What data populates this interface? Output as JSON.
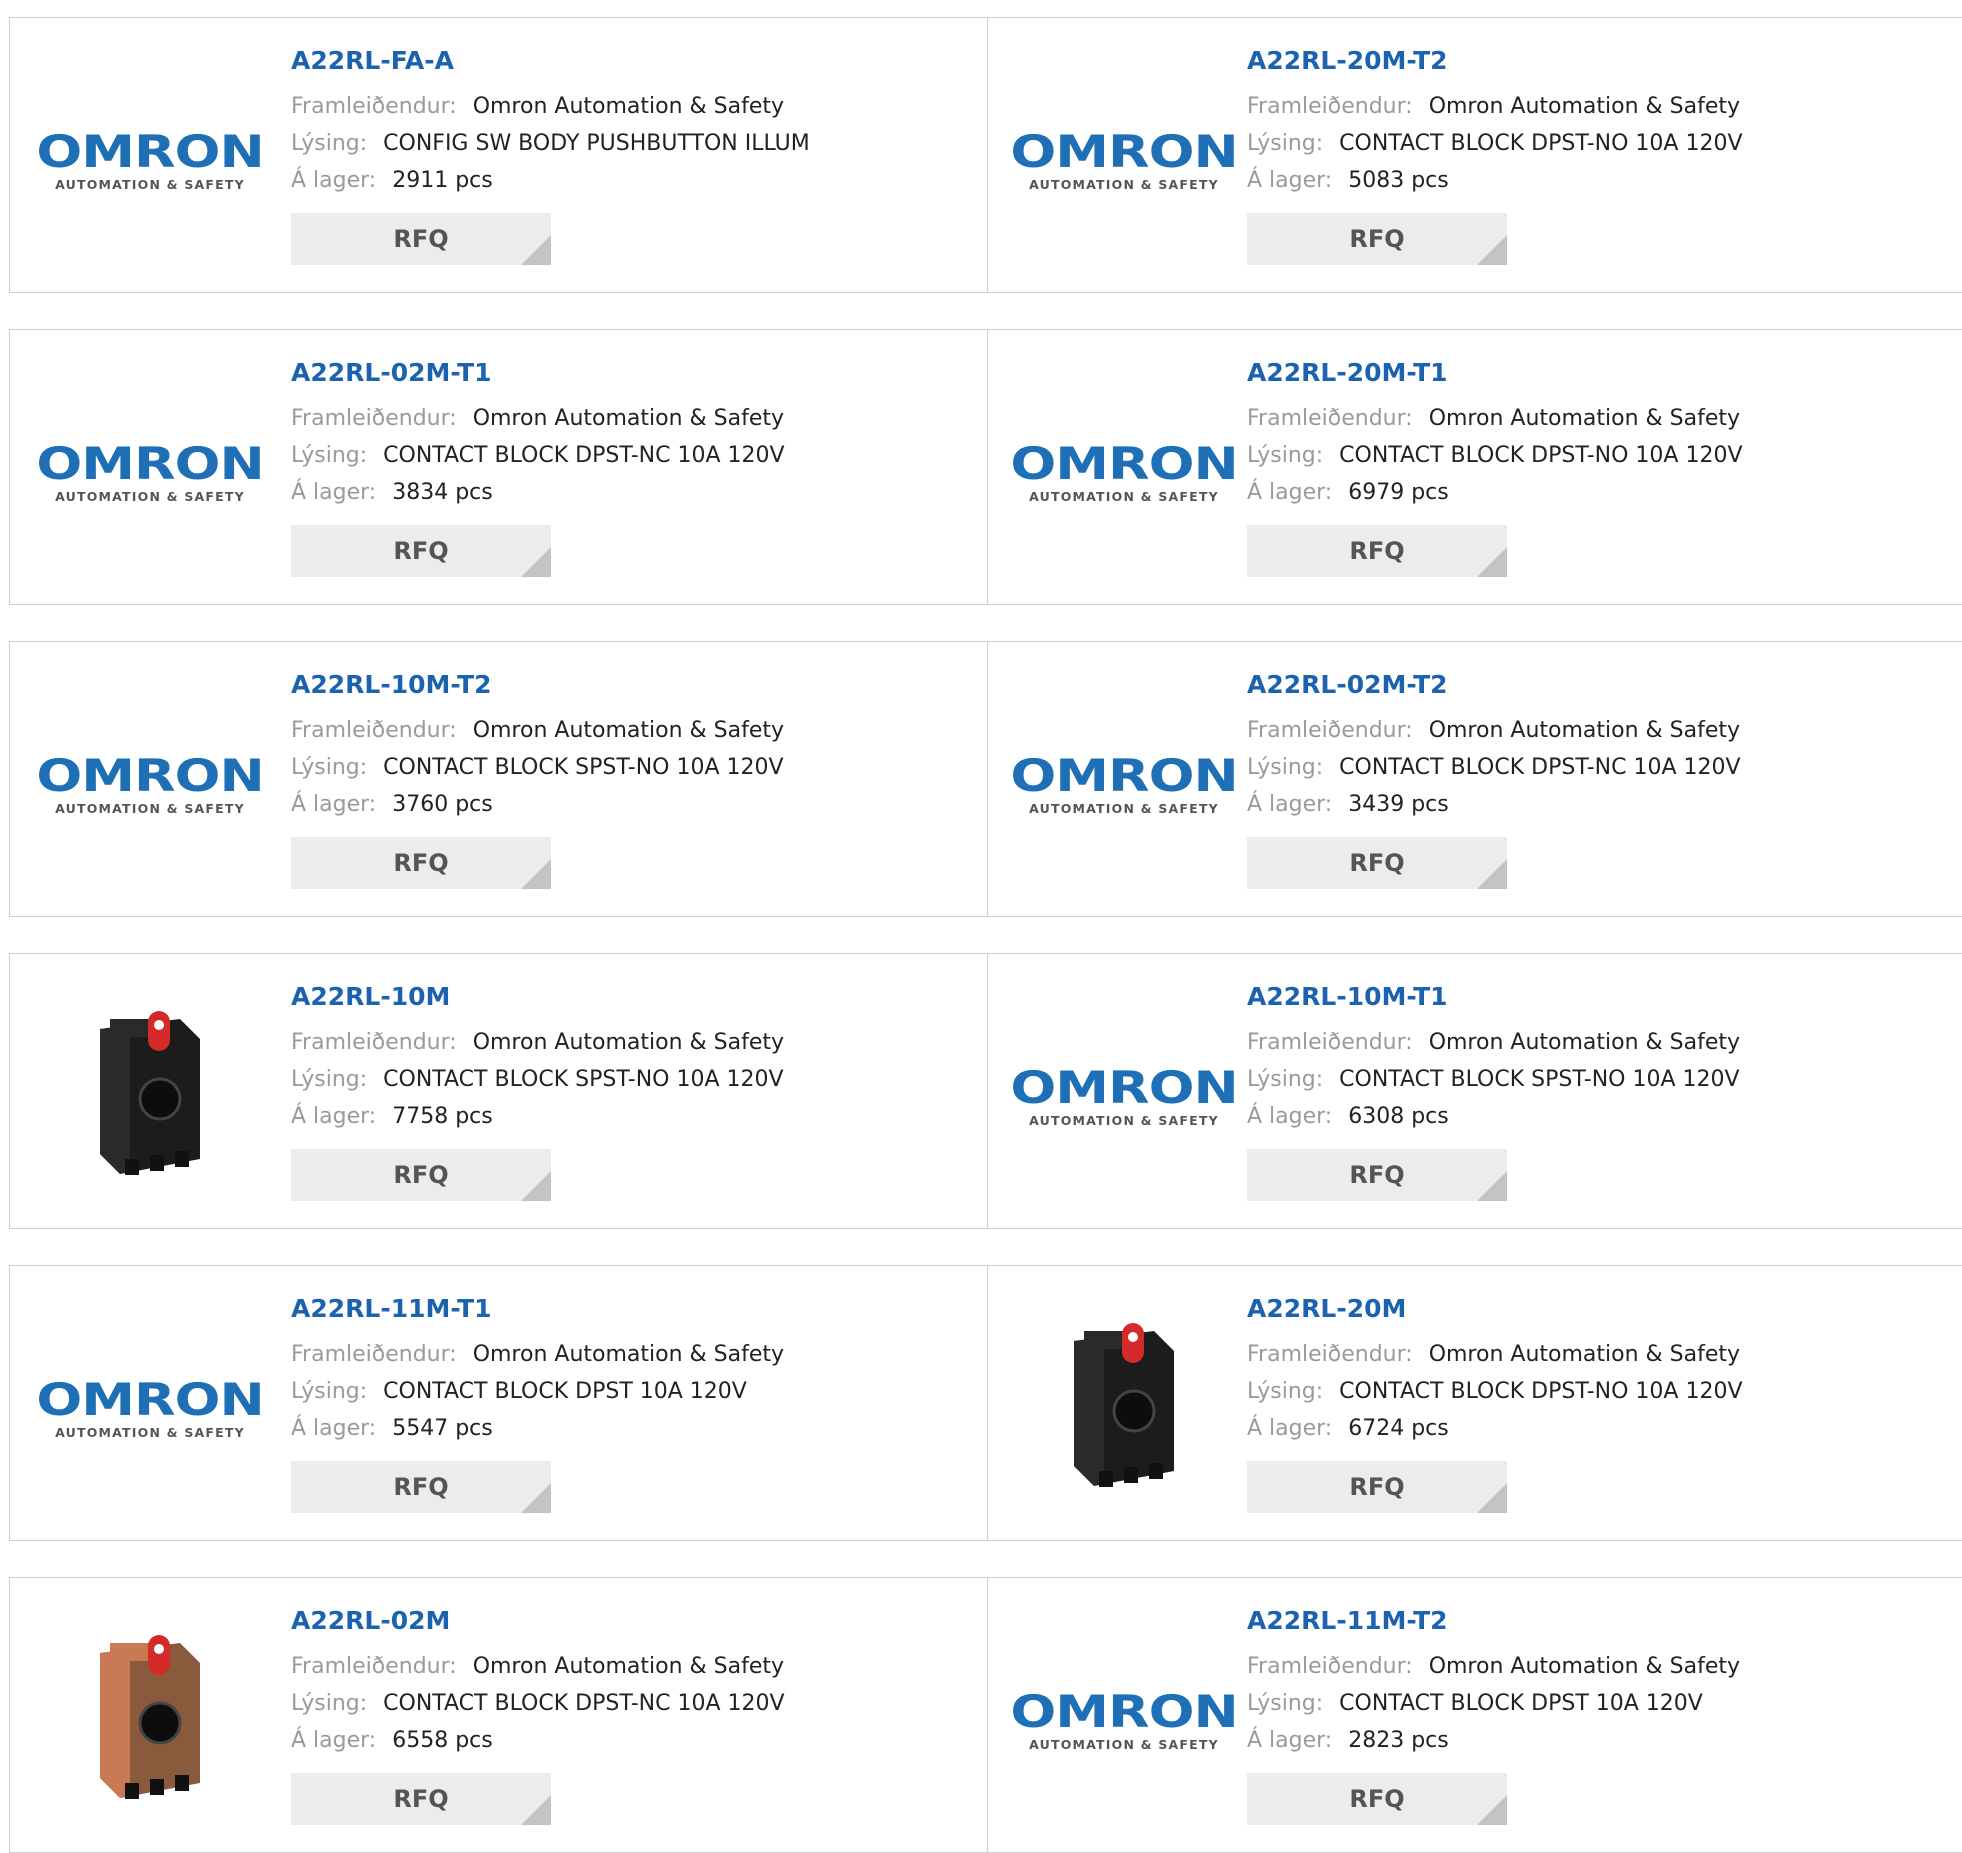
{
  "labels": {
    "manufacturer": "Framleiðendur:",
    "description": "Lýsing:",
    "stock": "Á lager:",
    "rfq": "RFQ"
  },
  "logo": {
    "word": "OMRON",
    "sub": "AUTOMATION & SAFETY"
  },
  "products": [
    {
      "part": "A22RL-FA-A",
      "manufacturer": "Omron Automation & Safety",
      "description": "CONFIG SW BODY PUSHBUTTON ILLUM",
      "stock": "2911 pcs",
      "image": "omron-logo"
    },
    {
      "part": "A22RL-20M-T2",
      "manufacturer": "Omron Automation & Safety",
      "description": "CONTACT BLOCK DPST-NO 10A 120V",
      "stock": "5083 pcs",
      "image": "omron-logo"
    },
    {
      "part": "A22RL-02M-T1",
      "manufacturer": "Omron Automation & Safety",
      "description": "CONTACT BLOCK DPST-NC 10A 120V",
      "stock": "3834 pcs",
      "image": "omron-logo"
    },
    {
      "part": "A22RL-20M-T1",
      "manufacturer": "Omron Automation & Safety",
      "description": "CONTACT BLOCK DPST-NO 10A 120V",
      "stock": "6979 pcs",
      "image": "omron-logo"
    },
    {
      "part": "A22RL-10M-T2",
      "manufacturer": "Omron Automation & Safety",
      "description": "CONTACT BLOCK SPST-NO 10A 120V",
      "stock": "3760 pcs",
      "image": "omron-logo"
    },
    {
      "part": "A22RL-02M-T2",
      "manufacturer": "Omron Automation & Safety",
      "description": "CONTACT BLOCK DPST-NC 10A 120V",
      "stock": "3439 pcs",
      "image": "omron-logo"
    },
    {
      "part": "A22RL-10M",
      "manufacturer": "Omron Automation & Safety",
      "description": "CONTACT BLOCK SPST-NO 10A 120V",
      "stock": "7758 pcs",
      "image": "contact-block-black-photo"
    },
    {
      "part": "A22RL-10M-T1",
      "manufacturer": "Omron Automation & Safety",
      "description": "CONTACT BLOCK SPST-NO 10A 120V",
      "stock": "6308 pcs",
      "image": "omron-logo"
    },
    {
      "part": "A22RL-11M-T1",
      "manufacturer": "Omron Automation & Safety",
      "description": "CONTACT BLOCK DPST 10A 120V",
      "stock": "5547 pcs",
      "image": "omron-logo"
    },
    {
      "part": "A22RL-20M",
      "manufacturer": "Omron Automation & Safety",
      "description": "CONTACT BLOCK DPST-NO 10A 120V",
      "stock": "6724 pcs",
      "image": "contact-block-black-photo"
    },
    {
      "part": "A22RL-02M",
      "manufacturer": "Omron Automation & Safety",
      "description": "CONTACT BLOCK DPST-NC 10A 120V",
      "stock": "6558 pcs",
      "image": "contact-block-brown-photo"
    },
    {
      "part": "A22RL-11M-T2",
      "manufacturer": "Omron Automation & Safety",
      "description": "CONTACT BLOCK DPST 10A 120V",
      "stock": "2823 pcs",
      "image": "omron-logo"
    }
  ],
  "colors": {
    "part_link": "#1b63ae",
    "logo_blue": "#1e6fb5",
    "label_gray": "#9a9a9a",
    "button_bg": "#ececec",
    "border": "#cfcfcf"
  }
}
